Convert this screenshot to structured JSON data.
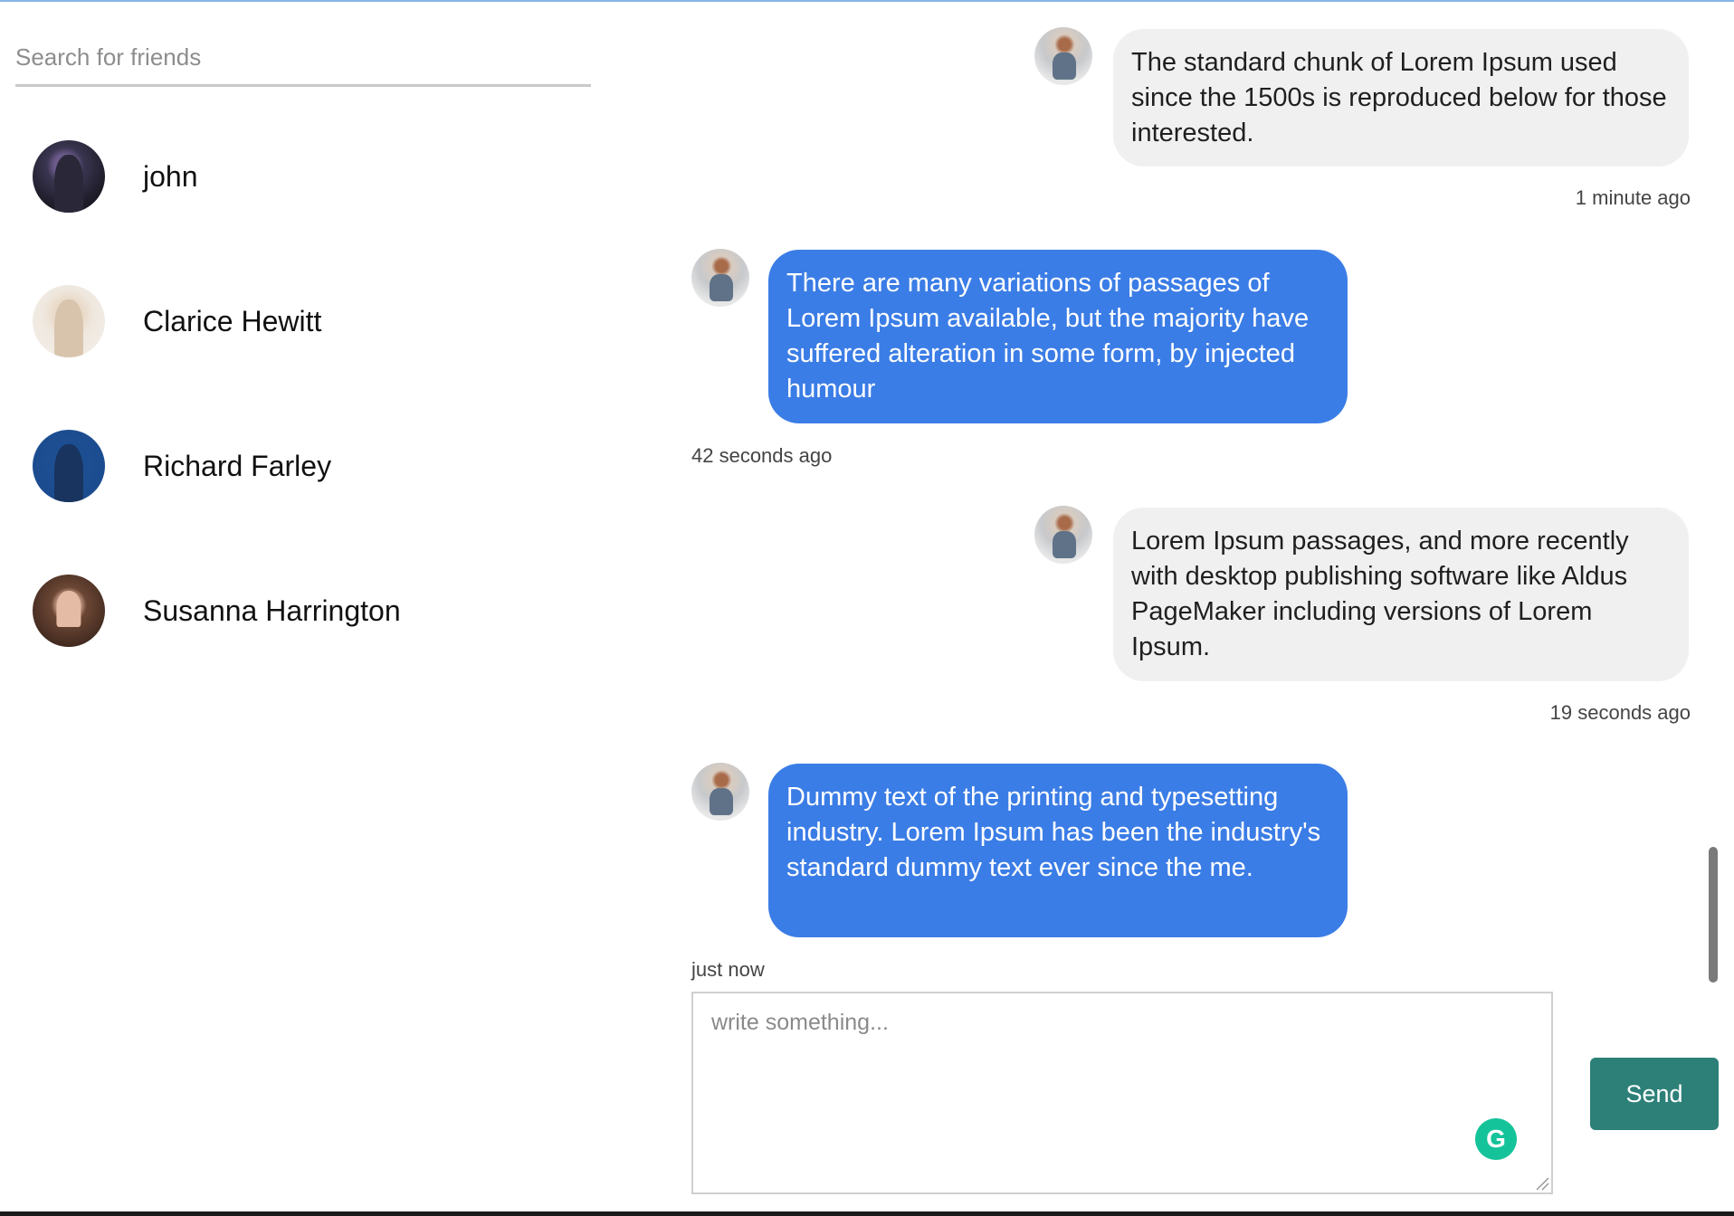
{
  "search": {
    "placeholder": "Search for friends"
  },
  "friends": [
    {
      "name": "john",
      "avatar": "avatar-john"
    },
    {
      "name": "Clarice Hewitt",
      "avatar": "avatar-clarice"
    },
    {
      "name": "Richard Farley",
      "avatar": "avatar-richard"
    },
    {
      "name": "Susanna Harrington",
      "avatar": "avatar-susanna"
    }
  ],
  "messages": [
    {
      "side": "received",
      "text": "The standard chunk of Lorem Ipsum used since the 1500s is reproduced below for those interested.",
      "time": "1 minute ago"
    },
    {
      "side": "sent",
      "text": "There are many variations of passages of Lorem Ipsum available, but the majority have suffered alteration in some form, by injected humour",
      "time": "42 seconds ago"
    },
    {
      "side": "received",
      "text": "Lorem Ipsum passages, and more recently with desktop publishing software like Aldus PageMaker including versions of Lorem Ipsum.",
      "time": "19 seconds ago"
    },
    {
      "side": "sent",
      "text": "Dummy text of the printing and typesetting industry. Lorem Ipsum has been the industry's standard dummy text ever since the me.",
      "time": "just now"
    }
  ],
  "composer": {
    "placeholder": "write something...",
    "grammar_badge": "G"
  },
  "send": {
    "label": "Send"
  },
  "colors": {
    "sent_bubble": "#3b7de6",
    "received_bubble": "#f1f0f0",
    "send_button": "#2d8078"
  }
}
